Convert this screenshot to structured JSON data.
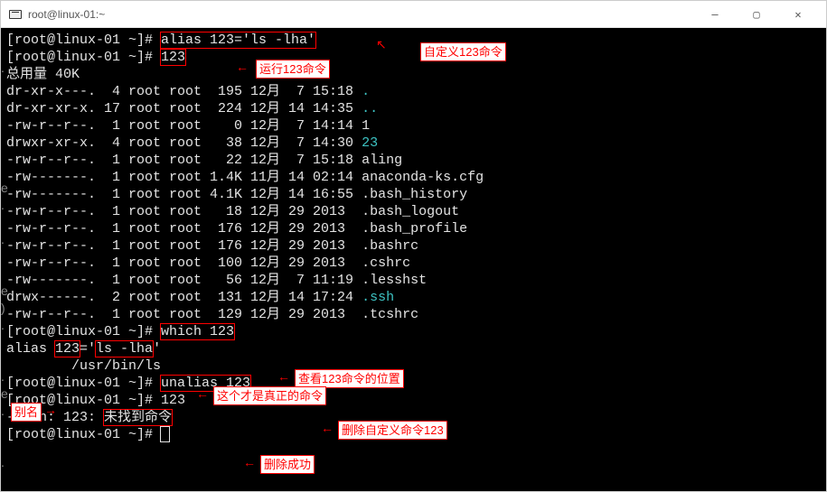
{
  "titlebar": {
    "title": "root@linux-01:~",
    "min": "—",
    "max": "▢",
    "close": "✕"
  },
  "prompt": "[root@linux-01 ~]# ",
  "cmds": {
    "alias": "alias 123='ls -lha'",
    "run123": "123",
    "which": "which 123",
    "unalias": "unalias 123",
    "notfound": "未找到命令"
  },
  "annotations": {
    "define": "自定义123命令",
    "run": "运行123命令",
    "viewpos": "查看123命令的位置",
    "realcmd": "这个才是真正的命令",
    "aliasname": "别名",
    "delcmd": "删除自定义命令123",
    "delok": "删除成功"
  },
  "listing": {
    "total": "总用量 40K",
    "rows": [
      {
        "perm": "dr-xr-x---.",
        "lnk": " 4",
        "own": "root root",
        "size": " 195",
        "mon": "12月",
        "day": " 7",
        "time": "15:18",
        "name": ".",
        "cls": "cyan"
      },
      {
        "perm": "dr-xr-xr-x.",
        "lnk": "17",
        "own": "root root",
        "size": " 224",
        "mon": "12月",
        "day": "14",
        "time": "14:35",
        "name": "..",
        "cls": "cyan"
      },
      {
        "perm": "-rw-r--r--.",
        "lnk": " 1",
        "own": "root root",
        "size": "   0",
        "mon": "12月",
        "day": " 7",
        "time": "14:14",
        "name": "1",
        "cls": "white"
      },
      {
        "perm": "drwxr-xr-x.",
        "lnk": " 4",
        "own": "root root",
        "size": "  38",
        "mon": "12月",
        "day": " 7",
        "time": "14:30",
        "name": "23",
        "cls": "cyan"
      },
      {
        "perm": "-rw-r--r--.",
        "lnk": " 1",
        "own": "root root",
        "size": "  22",
        "mon": "12月",
        "day": " 7",
        "time": "15:18",
        "name": "aling",
        "cls": "white"
      },
      {
        "perm": "-rw-------.",
        "lnk": " 1",
        "own": "root root",
        "size": "1.4K",
        "mon": "11月",
        "day": "14",
        "time": "02:14",
        "name": "anaconda-ks.cfg",
        "cls": "white"
      },
      {
        "perm": "-rw-------.",
        "lnk": " 1",
        "own": "root root",
        "size": "4.1K",
        "mon": "12月",
        "day": "14",
        "time": "16:55",
        "name": ".bash_history",
        "cls": "white"
      },
      {
        "perm": "-rw-r--r--.",
        "lnk": " 1",
        "own": "root root",
        "size": "  18",
        "mon": "12月",
        "day": "29",
        "time": "2013 ",
        "name": ".bash_logout",
        "cls": "white"
      },
      {
        "perm": "-rw-r--r--.",
        "lnk": " 1",
        "own": "root root",
        "size": " 176",
        "mon": "12月",
        "day": "29",
        "time": "2013 ",
        "name": ".bash_profile",
        "cls": "white"
      },
      {
        "perm": "-rw-r--r--.",
        "lnk": " 1",
        "own": "root root",
        "size": " 176",
        "mon": "12月",
        "day": "29",
        "time": "2013 ",
        "name": ".bashrc",
        "cls": "white"
      },
      {
        "perm": "-rw-r--r--.",
        "lnk": " 1",
        "own": "root root",
        "size": " 100",
        "mon": "12月",
        "day": "29",
        "time": "2013 ",
        "name": ".cshrc",
        "cls": "white"
      },
      {
        "perm": "-rw-------.",
        "lnk": " 1",
        "own": "root root",
        "size": "  56",
        "mon": "12月",
        "day": " 7",
        "time": "11:19",
        "name": ".lesshst",
        "cls": "white"
      },
      {
        "perm": "drwx------.",
        "lnk": " 2",
        "own": "root root",
        "size": " 131",
        "mon": "12月",
        "day": "14",
        "time": "17:24",
        "name": ".ssh",
        "cls": "cyan"
      },
      {
        "perm": "-rw-r--r--.",
        "lnk": " 1",
        "own": "root root",
        "size": " 129",
        "mon": "12月",
        "day": "29",
        "time": "2013 ",
        "name": ".tcshrc",
        "cls": "white"
      }
    ]
  },
  "whichout": {
    "line1_a": "alias ",
    "line1_b": "123",
    "line1_c": "='",
    "line1_d": "ls -lha",
    "line1_e": "'",
    "line2": "        /usr/bin/ls"
  },
  "bash_err_a": "-bash: 123: "
}
